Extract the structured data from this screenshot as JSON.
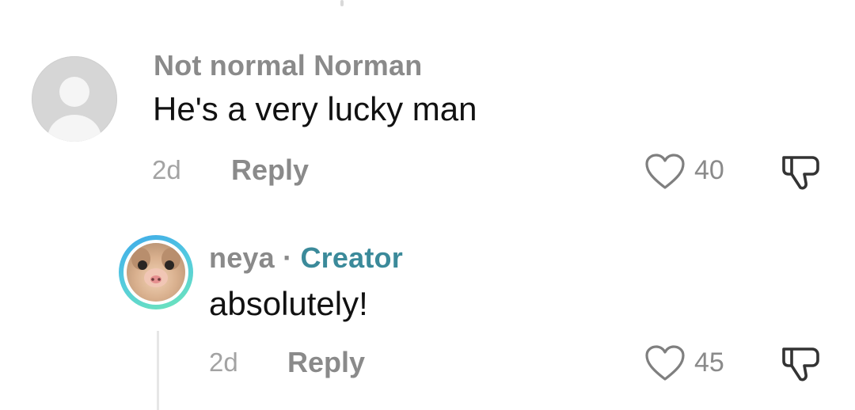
{
  "comments": [
    {
      "username": "Not normal Norman",
      "text": "He's a very lucky man",
      "date": "2d",
      "reply_label": "Reply",
      "likes": "40"
    },
    {
      "username": "neya",
      "separator": "·",
      "badge": "Creator",
      "text": "absolutely!",
      "date": "2d",
      "reply_label": "Reply",
      "likes": "45"
    }
  ],
  "icons": {
    "default_avatar": "person-silhouette-icon",
    "like": "heart-outline-icon",
    "dislike": "thumbs-down-icon"
  },
  "colors": {
    "creator_badge": "#3b8a9a",
    "muted_text": "#8a8a8a",
    "avatar_ring_start": "#3fa9e8",
    "avatar_ring_end": "#6ee6b8"
  }
}
